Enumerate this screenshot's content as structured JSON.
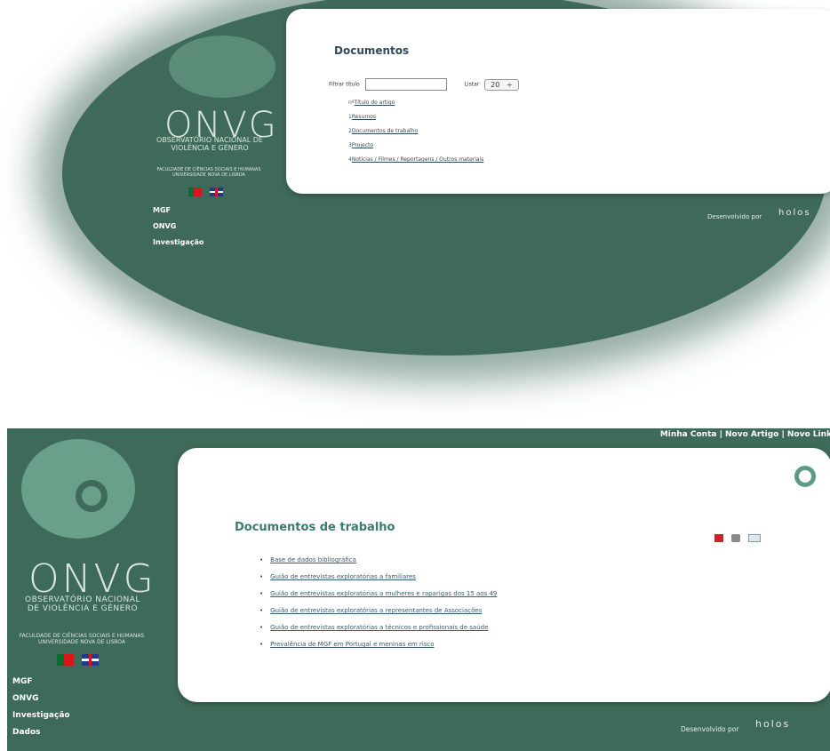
{
  "top": {
    "logo_text": "ONVG",
    "observatory": "OBSERVATÓRIO NACIONAL DE VIOLÊNCIA E GÉNERO",
    "faculty": "FACULDADE DE CIÊNCIAS SOCIAIS E HUMANAS UNIVERSIDADE NOVA DE LISBOA",
    "menu": [
      "MGF",
      "ONVG",
      "Investigação"
    ],
    "card": {
      "title": "Documentos",
      "filter_label": "Filtrar título",
      "filter_value": "",
      "list_label": "Listar",
      "list_value": "20",
      "list_arrow": "÷",
      "header_num": "nº",
      "header_title": "Título do artigo",
      "items": [
        {
          "n": "1",
          "label": "Resumos"
        },
        {
          "n": "2",
          "label": "Documentos de trabalho"
        },
        {
          "n": "3",
          "label": "Projecto"
        },
        {
          "n": "4",
          "label": "Notícias / Filmes / Reportagens / Outros materiais"
        }
      ]
    },
    "developed_by": "Desenvolvido por",
    "brand": "holos"
  },
  "bottom": {
    "top_links": "Minha Conta | Novo Artigo | Novo Link",
    "logo_text": "ONVG",
    "observatory_line1": "OBSERVATÓRIO NACIONAL",
    "observatory_line2": "DE VIOLÊNCIA E GÉNERO",
    "faculty_line1": "FACULDADE DE CIÊNCIAS SOCIAIS E HUMANAS",
    "faculty_line2": "UNIVERSIDADE NOVA DE LISBOA",
    "menu": [
      "MGF",
      "ONVG",
      "Investigação",
      "Dados"
    ],
    "card": {
      "title": "Documentos de trabalho",
      "items": [
        "Base de dados bibliográfica",
        "Guião de entrevistas exploratórias a familiares",
        "Guião de entrevistas exploratórias a mulheres e raparigas dos 15 aos 49",
        "Guião de entrevistas exploratórias a representantes de Associações",
        "Guião de entrevistas exploratórias a técnicos e profissionais de saúde",
        "Prevalência de MGF em Portugal e meninas em risco"
      ]
    },
    "developed_by": "Desenvolvido por",
    "brand": "holos"
  },
  "colors": {
    "background_green": "#3e6a5a",
    "logo_green": "#6aa08a",
    "title_green": "#3a7b6d",
    "link_blue": "#3a5b6e"
  },
  "icons": [
    "pdf-icon",
    "print-icon",
    "email-icon",
    "ring-icon",
    "flag-pt-icon",
    "flag-uk-icon"
  ]
}
